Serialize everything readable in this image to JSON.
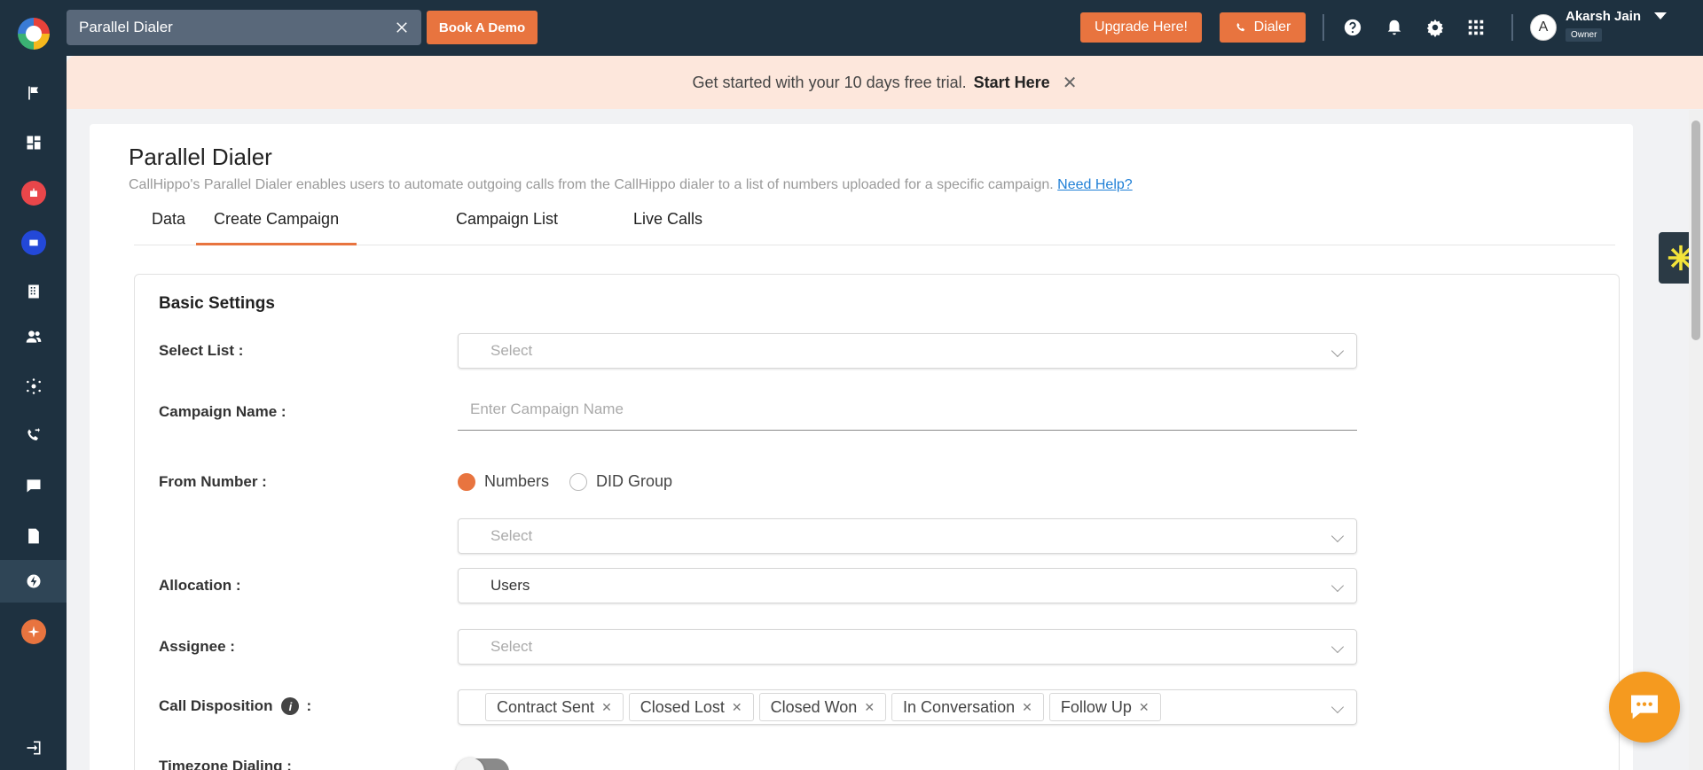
{
  "topbar": {
    "search_value": "Parallel Dialer",
    "book_demo": "Book A Demo",
    "upgrade": "Upgrade Here!",
    "dialer": "Dialer",
    "user_initial": "A",
    "user_name": "Akarsh Jain",
    "user_role": "Owner"
  },
  "banner": {
    "text": "Get started with your 10 days free trial.",
    "cta": "Start Here"
  },
  "page": {
    "title": "Parallel Dialer",
    "description": "CallHippo's Parallel Dialer enables users to automate outgoing calls from the CallHippo dialer to a list of numbers uploaded for a specific campaign.",
    "help_link": "Need Help?"
  },
  "tabs": [
    {
      "label": "Data"
    },
    {
      "label": "Create Campaign"
    },
    {
      "label": "Campaign List"
    },
    {
      "label": "Live Calls"
    }
  ],
  "settings": {
    "title": "Basic Settings",
    "select_list_label": "Select List :",
    "select_list_placeholder": "Select",
    "campaign_name_label": "Campaign Name :",
    "campaign_name_placeholder": "Enter Campaign Name",
    "from_number_label": "From Number :",
    "radio_numbers": "Numbers",
    "radio_did_group": "DID Group",
    "from_number_placeholder": "Select",
    "allocation_label": "Allocation :",
    "allocation_value": "Users",
    "assignee_label": "Assignee :",
    "assignee_placeholder": "Select",
    "disposition_label": "Call Disposition",
    "disposition_suffix": ":",
    "dispositions": [
      "Contract Sent",
      "Closed Lost",
      "Closed Won",
      "In Conversation",
      "Follow Up"
    ],
    "timezone_label": "Timezone Dialing :"
  }
}
